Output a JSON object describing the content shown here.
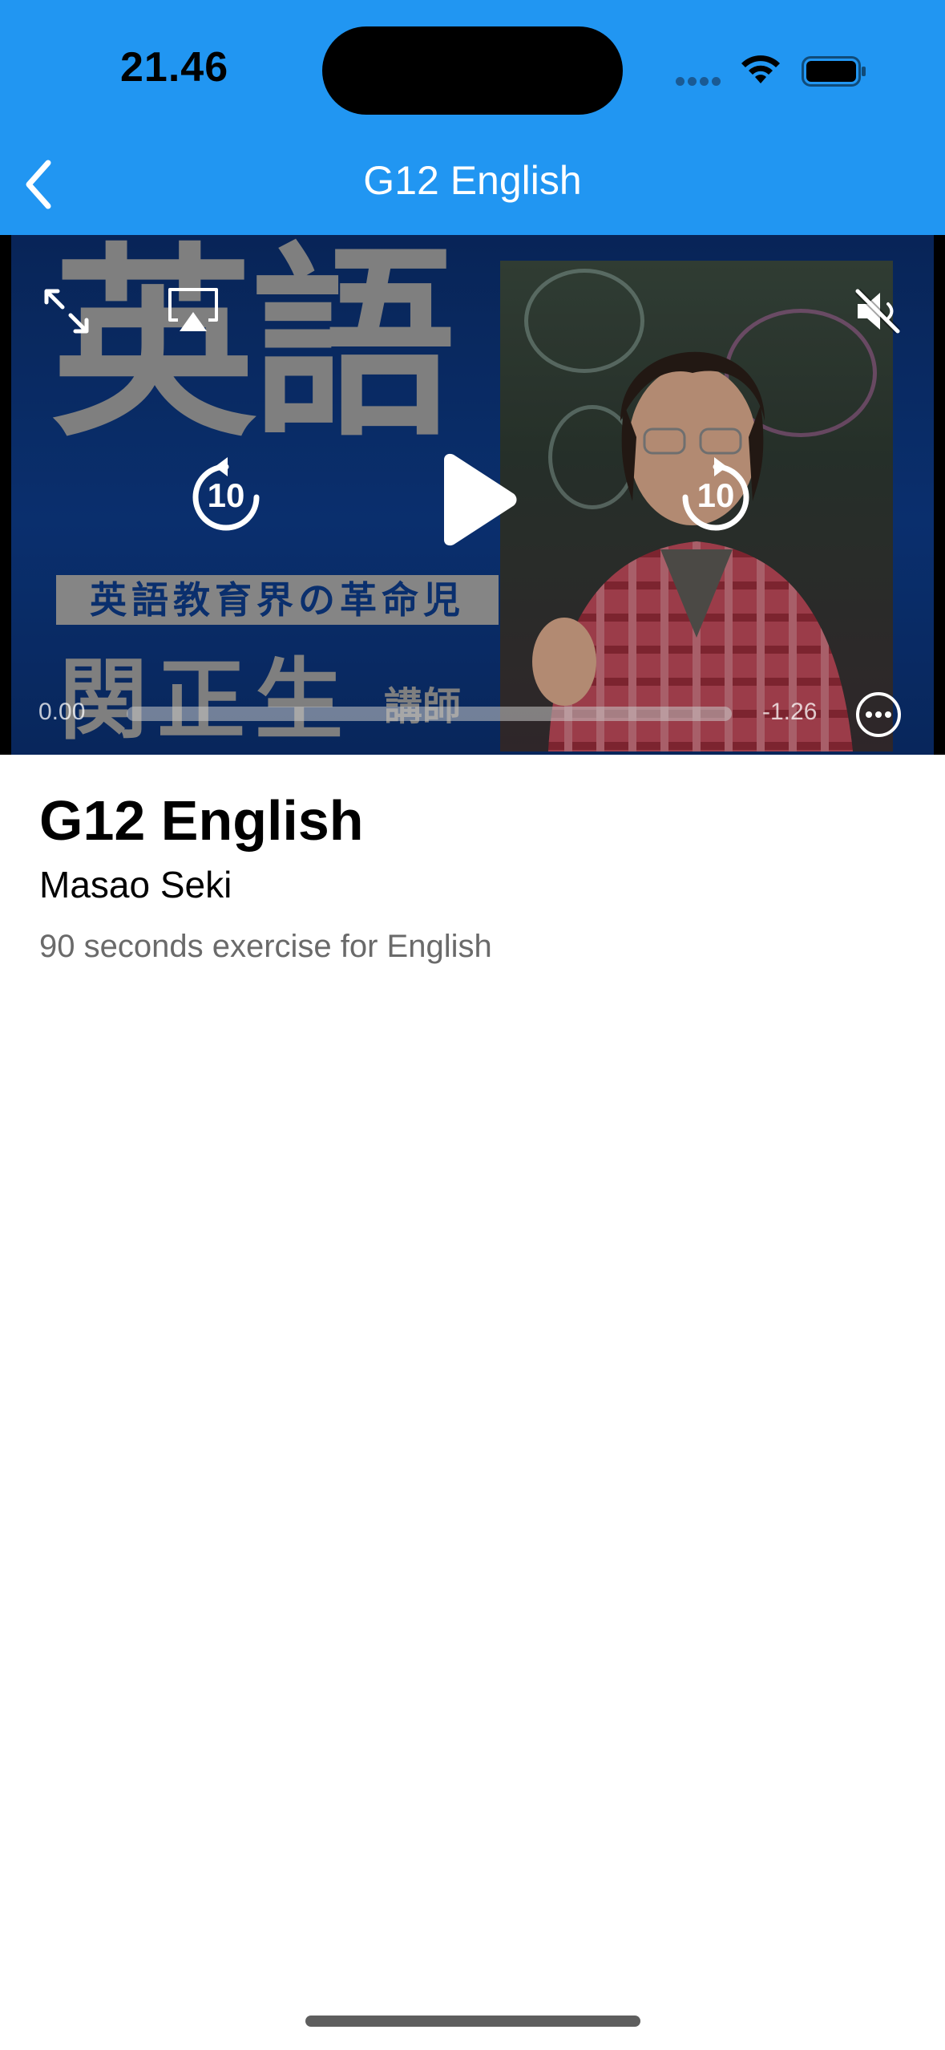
{
  "status_bar": {
    "time": "21.46"
  },
  "nav": {
    "title": "G12 English",
    "back_icon": "chevron-left-icon"
  },
  "video": {
    "thumbnail": {
      "big_title": "英語",
      "banner": "英語教育界の革命児",
      "name": "関正生",
      "name_suffix": "講師"
    },
    "elapsed": "0.00",
    "remaining": "-1.26",
    "progress": 0,
    "controls": {
      "fullscreen_icon": "expand-icon",
      "airplay_icon": "airplay-icon",
      "mute_icon": "speaker-muted-icon",
      "skip_back_icon": "skip-back-10-icon",
      "play_icon": "play-icon",
      "skip_forward_icon": "skip-forward-10-icon",
      "more_icon": "more-icon",
      "skip_seconds": "10"
    }
  },
  "details": {
    "title": "G12 English",
    "author": "Masao Seki",
    "description": "90 seconds exercise for English"
  },
  "colors": {
    "nav_bg": "#2196F2",
    "nav_text": "#FFFFFF"
  }
}
